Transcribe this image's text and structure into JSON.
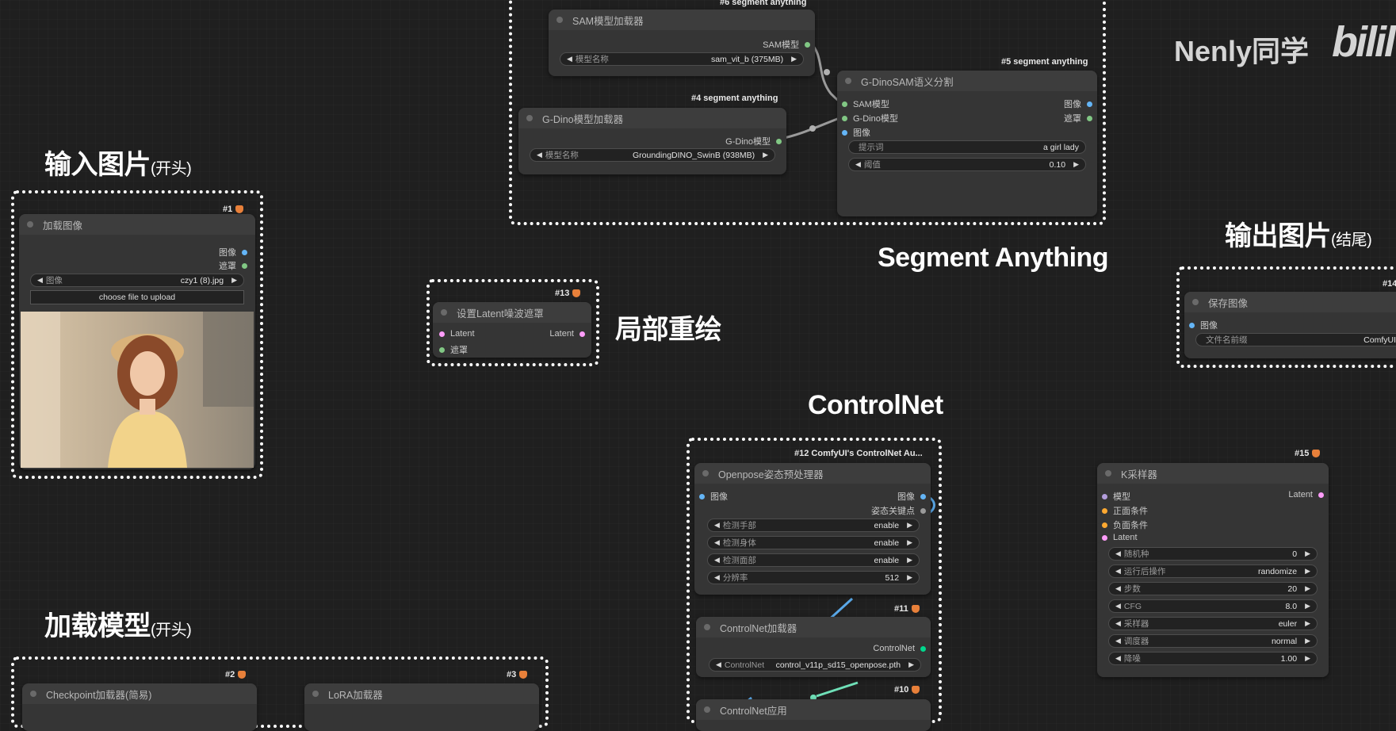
{
  "labels": {
    "input_image": "输入图片",
    "input_image_sub": "(开头)",
    "load_model": "加载模型",
    "load_model_sub": "(开头)",
    "output_image": "输出图片",
    "output_image_sub": "(结尾)",
    "inpaint": "局部重绘",
    "controlnet": "ControlNet",
    "segment_anything": "Segment Anything"
  },
  "watermark": {
    "author": "Nenly同学",
    "site": "bilil"
  },
  "nodes": {
    "load_image": {
      "badge": "#1",
      "title": "加载图像",
      "out_image": "图像",
      "out_mask": "遮罩",
      "widget_name": "图像",
      "widget_value": "czy1 (8).jpg",
      "upload_label": "choose file to upload"
    },
    "set_latent_mask": {
      "badge": "#13",
      "title": "设置Latent噪波遮罩",
      "in_latent": "Latent",
      "in_mask": "遮罩",
      "out_latent": "Latent"
    },
    "sam_loader": {
      "badge": "#6 segment anything",
      "title": "SAM模型加载器",
      "out_model": "SAM模型",
      "widget_name": "模型名称",
      "widget_value": "sam_vit_b (375MB)"
    },
    "gdino_loader": {
      "badge": "#4 segment anything",
      "title": "G-Dino模型加载器",
      "out_model": "G-Dino模型",
      "widget_name": "模型名称",
      "widget_value": "GroundingDINO_SwinB (938MB)"
    },
    "gdino_sam": {
      "badge": "#5 segment anything",
      "title": "G-DinoSAM语义分割",
      "in_sam": "SAM模型",
      "in_gdino": "G-Dino模型",
      "in_image": "图像",
      "out_image": "图像",
      "out_mask": "遮罩",
      "prompt_name": "提示词",
      "prompt_value": "a girl lady",
      "threshold_name": "阈值",
      "threshold_value": "0.10"
    },
    "save_image": {
      "badge": "#14",
      "title": "保存图像",
      "in_image": "图像",
      "widget_name": "文件名前缀",
      "widget_value": "ComfyUI"
    },
    "openpose": {
      "badge": "#12 ComfyUI's ControlNet Au...",
      "title": "Openpose姿态预处理器",
      "in_image": "图像",
      "out_image": "图像",
      "out_keypoints": "姿态关键点",
      "widgets": [
        {
          "name": "检测手部",
          "value": "enable"
        },
        {
          "name": "检测身体",
          "value": "enable"
        },
        {
          "name": "检测面部",
          "value": "enable"
        },
        {
          "name": "分辨率",
          "value": "512"
        }
      ]
    },
    "controlnet_loader": {
      "badge": "#11",
      "title": "ControlNet加载器",
      "out_controlnet": "ControlNet",
      "widget_name": "ControlNet",
      "widget_value": "control_v11p_sd15_openpose.pth"
    },
    "controlnet_apply": {
      "badge": "#10",
      "title": "ControlNet应用"
    },
    "ksampler": {
      "badge": "#15",
      "title": "K采样器",
      "in_model": "模型",
      "in_positive": "正面条件",
      "in_negative": "负面条件",
      "in_latent": "Latent",
      "out_latent": "Latent",
      "widgets": [
        {
          "name": "随机种",
          "value": "0"
        },
        {
          "name": "运行后操作",
          "value": "randomize"
        },
        {
          "name": "步数",
          "value": "20"
        },
        {
          "name": "CFG",
          "value": "8.0"
        },
        {
          "name": "采样器",
          "value": "euler"
        },
        {
          "name": "调度器",
          "value": "normal"
        },
        {
          "name": "降噪",
          "value": "1.00"
        }
      ]
    },
    "checkpoint_loader": {
      "badge": "#2",
      "title": "Checkpoint加载器(简易)"
    },
    "lora_loader": {
      "badge": "#3",
      "title": "LoRA加载器"
    }
  },
  "colors": {
    "canvas": "#1f1f1f",
    "node_body": "#353535",
    "pin_image": "#64b5f6",
    "pin_mask": "#81c784",
    "pin_latent": "#ff9cf9",
    "pin_condition": "#ffa931",
    "pin_model": "#b39ddb",
    "pin_controlnet": "#00d78d",
    "link_blue": "#5aa8e8",
    "link_green": "#6fe0b8"
  }
}
